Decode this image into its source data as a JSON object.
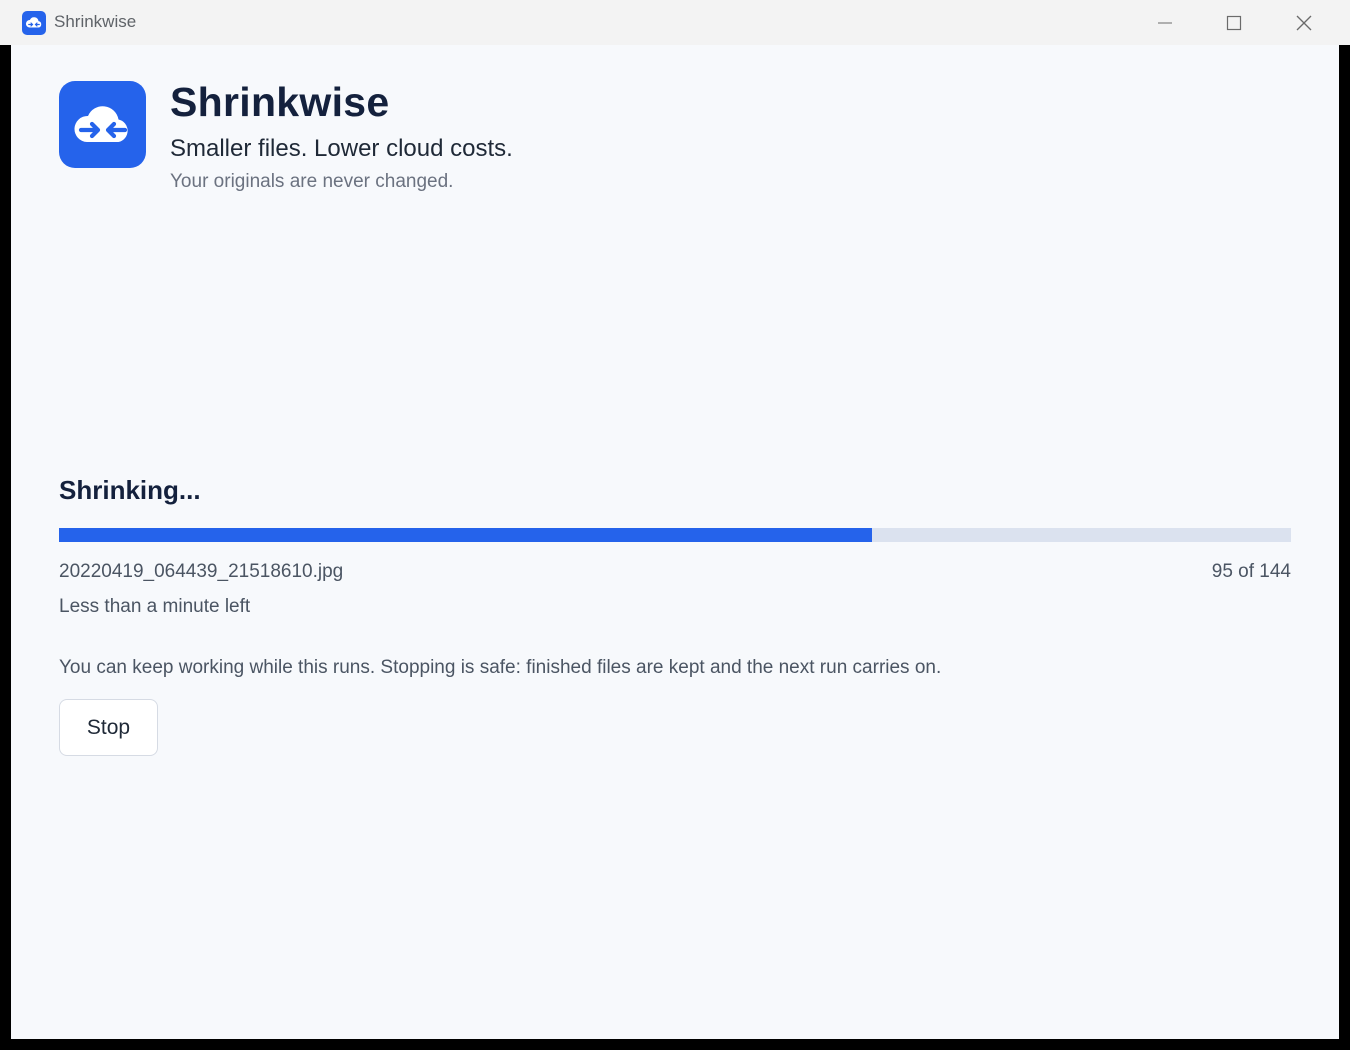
{
  "window": {
    "title": "Shrinkwise",
    "icon": "cloud-compress-icon",
    "controls": [
      "minimize-icon",
      "maximize-icon",
      "close-icon"
    ]
  },
  "header": {
    "app_name": "Shrinkwise",
    "tagline": "Smaller files. Lower cloud costs.",
    "subtagline": "Your originals are never changed.",
    "logo_icon": "cloud-compress-icon"
  },
  "progress": {
    "heading": "Shrinking...",
    "current_file": "20220419_064439_21518610.jpg",
    "count_text": "95 of 144",
    "fraction": 0.66,
    "time_left": "Less than a minute left",
    "info": "You can keep working while this runs. Stopping is safe: finished files are kept and the next run carries on.",
    "stop_label": "Stop"
  },
  "colors": {
    "accent": "#2563eb",
    "track": "#dbe2ef",
    "background": "#f7f9fc",
    "heading": "#14213d"
  }
}
